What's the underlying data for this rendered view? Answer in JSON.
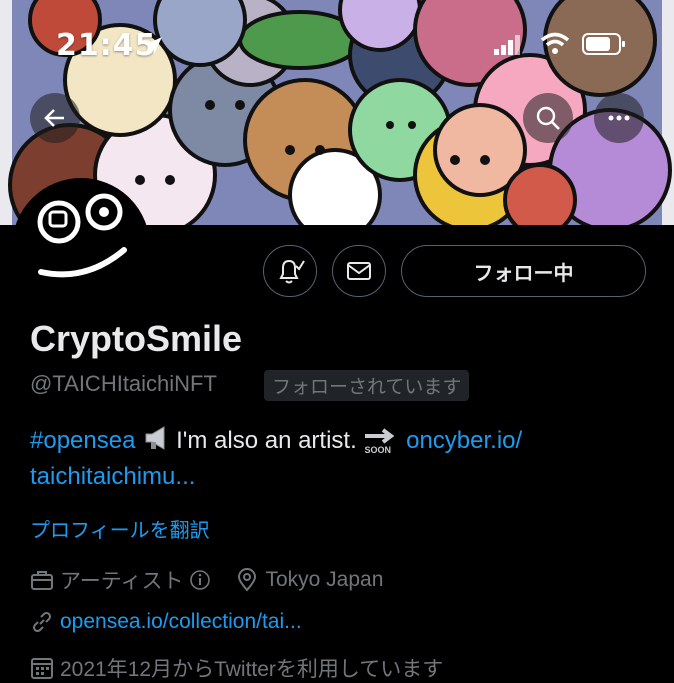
{
  "status_bar": {
    "time": "21:45"
  },
  "header": {
    "back_icon": "arrow-left-icon",
    "search_icon": "search-icon",
    "more_icon": "more-horizontal-icon"
  },
  "actions": {
    "notify_icon": "bell-check-icon",
    "message_icon": "mail-icon",
    "follow_label": "フォロー中"
  },
  "profile": {
    "name": "CryptoSmile",
    "handle": "@TAICHItaichiNFT",
    "follows_you": "フォローされています",
    "bio_hashtag": "#opensea",
    "bio_text": "I'm also an artist.",
    "bio_soon": "SOON",
    "bio_link1": "oncyber.io/",
    "bio_link2": "taichitaichimu...",
    "translate": "プロフィールを翻訳",
    "category": "アーティスト",
    "location": "Tokyo Japan",
    "website": "opensea.io/collection/tai...",
    "joined": "2021年12月からTwitterを利用しています"
  },
  "colors": {
    "accent": "#1d9bf0",
    "muted": "#71767b",
    "background": "#000000"
  }
}
